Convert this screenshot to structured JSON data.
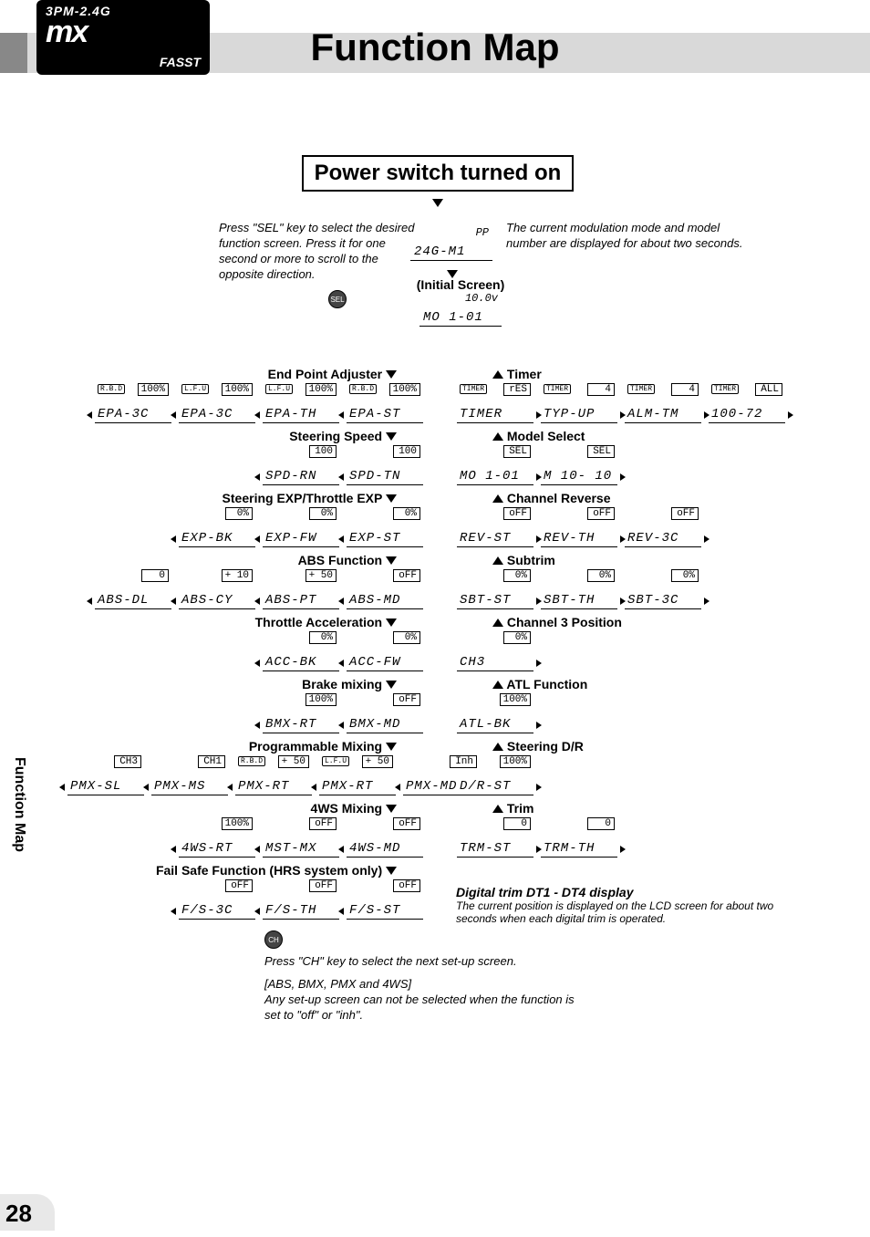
{
  "header": {
    "model": "3PM-2.4G",
    "logo_main": "mx",
    "logo_sub": "FASST",
    "page_title": "Function Map",
    "side_label": "Function Map",
    "page_number": "28"
  },
  "top_section": {
    "power_box": "Power switch turned on",
    "sel_note": "Press \"SEL\" key to select the desired function screen. Press it for one second or more to scroll to the opposite direction.",
    "sel_button": "SEL",
    "modulation_note": "The current modulation mode and model number are displayed for about two seconds.",
    "modulation_cell": {
      "top": "PP",
      "bottom": "24G-M1"
    },
    "initial_label": "(Initial Screen)",
    "initial_cell": {
      "top": "10.0v",
      "bottom": "MO 1-01"
    }
  },
  "left_groups": [
    {
      "label": "End Point Adjuster",
      "cells": [
        {
          "val": "100%",
          "tag": "R.B.D",
          "lbl": "EPA-3C"
        },
        {
          "val": "100%",
          "tag": "L.F.U",
          "lbl": "EPA-3C"
        },
        {
          "val": "100%",
          "tag": "L.F.U",
          "lbl": "EPA-TH"
        },
        {
          "val": "100%",
          "tag": "R.B.D",
          "lbl": "EPA-ST"
        }
      ]
    },
    {
      "label": "Steering Speed",
      "cells": [
        {
          "val": "100",
          "lbl": "SPD-RN"
        },
        {
          "val": "100",
          "lbl": "SPD-TN"
        }
      ]
    },
    {
      "label": "Steering EXP/Throttle EXP",
      "cells": [
        {
          "val": "0%",
          "lbl": "EXP-BK"
        },
        {
          "val": "0%",
          "lbl": "EXP-FW"
        },
        {
          "val": "0%",
          "lbl": "EXP-ST"
        }
      ]
    },
    {
      "label": "ABS Function",
      "cells": [
        {
          "val": "0",
          "lbl": "ABS-DL"
        },
        {
          "val": "+ 10",
          "lbl": "ABS-CY"
        },
        {
          "val": "+ 50",
          "lbl": "ABS-PT"
        },
        {
          "val": "oFF",
          "lbl": "ABS-MD"
        }
      ]
    },
    {
      "label": "Throttle Acceleration",
      "cells": [
        {
          "val": "0%",
          "lbl": "ACC-BK"
        },
        {
          "val": "0%",
          "lbl": "ACC-FW"
        }
      ]
    },
    {
      "label": "Brake mixing",
      "cells": [
        {
          "val": "100%",
          "lbl": "BMX-RT"
        },
        {
          "val": "oFF",
          "lbl": "BMX-MD"
        }
      ]
    },
    {
      "label": "Programmable Mixing",
      "cells": [
        {
          "val": "CH3",
          "lbl": "PMX-SL"
        },
        {
          "val": "CH1",
          "lbl": "PMX-MS"
        },
        {
          "val": "+ 50",
          "tag": "R.B.D",
          "lbl": "PMX-RT"
        },
        {
          "val": "+ 50",
          "tag": "L.F.U",
          "lbl": "PMX-RT"
        },
        {
          "val": "Inh",
          "lbl": "PMX-MD"
        }
      ]
    },
    {
      "label": "4WS Mixing",
      "cells": [
        {
          "val": "100%",
          "lbl": "4WS-RT"
        },
        {
          "val": "oFF",
          "lbl": "MST-MX"
        },
        {
          "val": "oFF",
          "lbl": "4WS-MD"
        }
      ]
    },
    {
      "label": "Fail Safe Function (HRS system only)",
      "cells": [
        {
          "val": "oFF",
          "lbl": "F/S-3C"
        },
        {
          "val": "oFF",
          "lbl": "F/S-TH"
        },
        {
          "val": "oFF",
          "lbl": "F/S-ST"
        }
      ]
    }
  ],
  "right_groups": [
    {
      "label": "Timer",
      "cells": [
        {
          "val": "rES",
          "tag": "TIMER",
          "lbl": "TIMER"
        },
        {
          "val": "4",
          "tag": "TIMER",
          "lbl": "TYP-UP"
        },
        {
          "val": "4",
          "tag": "TIMER",
          "lbl": "ALM-TM"
        },
        {
          "val": "ALL",
          "tag": "TIMER",
          "lbl": "100-72"
        }
      ]
    },
    {
      "label": "Model Select",
      "cells": [
        {
          "val": "SEL",
          "lbl": "MO 1-01"
        },
        {
          "val": "SEL",
          "lbl": "M 10- 10"
        }
      ]
    },
    {
      "label": "Channel Reverse",
      "cells": [
        {
          "val": "oFF",
          "lbl": "REV-ST"
        },
        {
          "val": "oFF",
          "lbl": "REV-TH"
        },
        {
          "val": "oFF",
          "lbl": "REV-3C"
        }
      ]
    },
    {
      "label": "Subtrim",
      "cells": [
        {
          "val": "0%",
          "lbl": "SBT-ST"
        },
        {
          "val": "0%",
          "lbl": "SBT-TH"
        },
        {
          "val": "0%",
          "lbl": "SBT-3C"
        }
      ]
    },
    {
      "label": "Channel 3 Position",
      "cells": [
        {
          "val": "0%",
          "lbl": "CH3"
        }
      ]
    },
    {
      "label": "ATL Function",
      "cells": [
        {
          "val": "100%",
          "lbl": "ATL-BK"
        }
      ]
    },
    {
      "label": "Steering D/R",
      "cells": [
        {
          "val": "100%",
          "lbl": "D/R-ST"
        }
      ]
    },
    {
      "label": "Trim",
      "cells": [
        {
          "val": "0",
          "lbl": "TRM-ST"
        },
        {
          "val": "0",
          "lbl": "TRM-TH"
        }
      ]
    }
  ],
  "bottom_notes": {
    "ch_button": "CH",
    "ch_note": "Press \"CH\" key to select the next set-up screen.",
    "abs_note_head": "[ABS, BMX, PMX and 4WS]",
    "abs_note_body": "Any set-up screen can not be selected when the function is set to \"off\" or \"inh\".",
    "dt_head": "Digital trim DT1 - DT4 display",
    "dt_body": "The current position is displayed on the LCD screen for about two seconds when each digital trim is operated."
  }
}
